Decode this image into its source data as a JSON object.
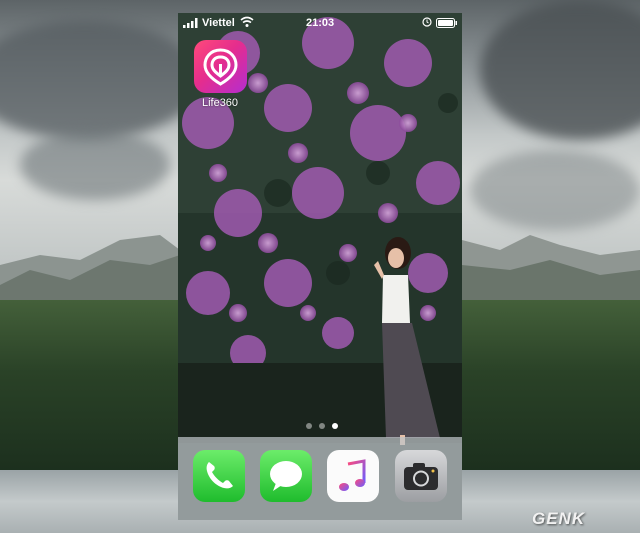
{
  "status_bar": {
    "carrier": "Viettel",
    "time": "21:03",
    "icons": [
      "signal-icon",
      "wifi-icon",
      "alarm-icon",
      "battery-icon"
    ]
  },
  "home_screen": {
    "apps": [
      {
        "label": "Life360",
        "icon": "life360-icon",
        "color": "#e52d8d"
      }
    ],
    "page_indicator": {
      "pages": 3,
      "current": 3
    }
  },
  "dock": {
    "apps": [
      {
        "name": "Phone",
        "icon": "phone-icon"
      },
      {
        "name": "Messages",
        "icon": "messages-icon"
      },
      {
        "name": "Music",
        "icon": "music-icon"
      },
      {
        "name": "Camera",
        "icon": "camera-icon"
      }
    ]
  },
  "watermark": {
    "text": "GENK"
  },
  "colors": {
    "life360_gradient_start": "#ff4a7a",
    "life360_gradient_end": "#b42dd0",
    "dock_green": "#1fbc2d",
    "dock_bg": "#bec4c8"
  }
}
